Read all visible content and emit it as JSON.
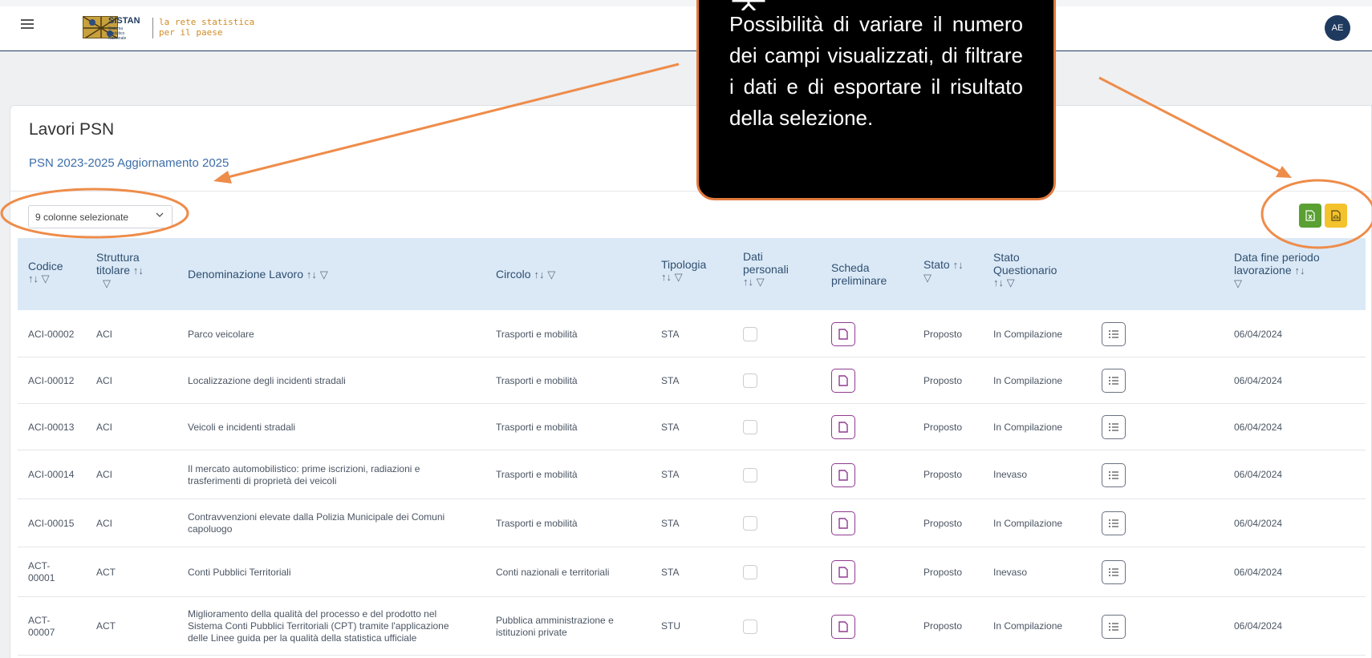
{
  "header": {
    "logo_name": "SISTAN",
    "logo_sub": "Sistema Statistico Nazionale",
    "tagline_line1": "la rete statistica",
    "tagline_line2": "per il paese",
    "avatar_initials": "AE",
    "brand_color": "#1f3a5f",
    "accent_color": "#d08b25"
  },
  "page": {
    "title": "Lavori PSN",
    "subtitle": "PSN 2023-2025 Aggiornamento 2025",
    "column_selector": "9 colonne selezionate",
    "export_excel_icon": "excel-file-icon",
    "export_pdf_icon": "pdf-file-icon"
  },
  "callout": {
    "icon": "presentation-icon",
    "text": "Possibilità di variare il numero dei campi visualizzati, di filtrare i dati e di esportare il risultato della selezione."
  },
  "table": {
    "headers": {
      "codice": "Codice",
      "struttura_1": "Struttura",
      "struttura_2": "titolare",
      "denominazione": "Denominazione Lavoro",
      "circolo": "Circolo",
      "tipologia": "Tipologia",
      "dati_1": "Dati",
      "dati_2": "personali",
      "scheda_1": "Scheda",
      "scheda_2": "preliminare",
      "stato": "Stato",
      "stato_q_1": "Stato",
      "stato_q_2": "Questionario",
      "data_1": "Data fine periodo",
      "data_2": "lavorazione"
    },
    "sort_glyph": "↑↓",
    "filter_glyph": "▽",
    "rows": [
      {
        "codice": "ACI-00002",
        "struttura": "ACI",
        "denominazione": "Parco veicolare",
        "circolo": "Trasporti e mobilità",
        "tipologia": "STA",
        "stato": "Proposto",
        "stato_q": "In Compilazione",
        "data": "06/04/2024"
      },
      {
        "codice": "ACI-00012",
        "struttura": "ACI",
        "denominazione": "Localizzazione degli incidenti stradali",
        "circolo": "Trasporti e mobilità",
        "tipologia": "STA",
        "stato": "Proposto",
        "stato_q": "In Compilazione",
        "data": "06/04/2024"
      },
      {
        "codice": "ACI-00013",
        "struttura": "ACI",
        "denominazione": "Veicoli e incidenti stradali",
        "circolo": "Trasporti e mobilità",
        "tipologia": "STA",
        "stato": "Proposto",
        "stato_q": "In Compilazione",
        "data": "06/04/2024"
      },
      {
        "codice": "ACI-00014",
        "struttura": "ACI",
        "denominazione_1": "Il mercato automobilistico: prime iscrizioni, radiazioni e",
        "denominazione_2": "trasferimenti di proprietà dei veicoli",
        "circolo": "Trasporti e mobilità",
        "tipologia": "STA",
        "stato": "Proposto",
        "stato_q": "Inevaso",
        "data": "06/04/2024"
      },
      {
        "codice": "ACI-00015",
        "struttura": "ACI",
        "denominazione_1": "Contravvenzioni elevate dalla Polizia Municipale dei Comuni",
        "denominazione_2": "capoluogo",
        "circolo": "Trasporti e mobilità",
        "tipologia": "STA",
        "stato": "Proposto",
        "stato_q": "In Compilazione",
        "data": "06/04/2024"
      },
      {
        "codice_1": "ACT-",
        "codice_2": "00001",
        "struttura": "ACT",
        "denominazione": "Conti Pubblici Territoriali",
        "circolo": "Conti nazionali e territoriali",
        "tipologia": "STA",
        "stato": "Proposto",
        "stato_q": "Inevaso",
        "data": "06/04/2024"
      },
      {
        "codice_1": "ACT-",
        "codice_2": "00007",
        "struttura": "ACT",
        "denominazione_1": "Miglioramento della qualità del processo e del prodotto nel",
        "denominazione_2": "Sistema Conti Pubblici Territoriali (CPT) tramite l'applicazione",
        "denominazione_3": "delle Linee guida per la qualità della statistica ufficiale",
        "circolo_1": "Pubblica amministrazione e",
        "circolo_2": "istituzioni private",
        "tipologia": "STU",
        "stato": "Proposto",
        "stato_q": "In Compilazione",
        "data": "06/04/2024"
      }
    ]
  }
}
